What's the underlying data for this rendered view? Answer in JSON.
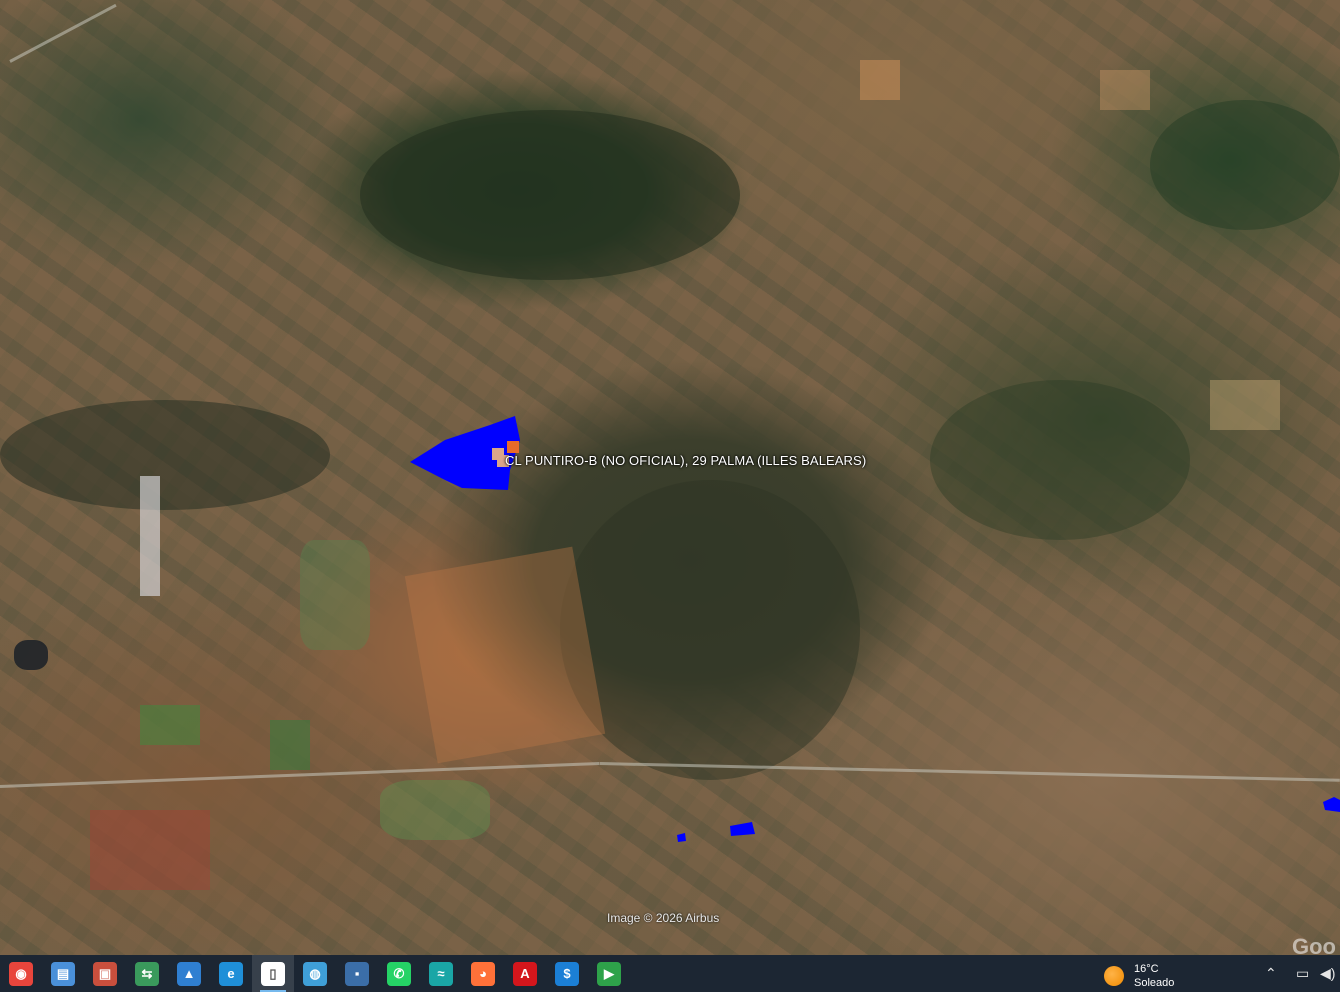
{
  "map": {
    "place_label": "CL PUNTIRO-B (NO OFICIAL), 29  PALMA (ILLES BALEARS)",
    "attribution": "Image © 2026 Airbus",
    "watermark": "Goo",
    "parcel_color": "#0000ff",
    "marker_colors": [
      "#e86a2a",
      "#d9a48a"
    ]
  },
  "taskbar": {
    "apps": [
      {
        "name": "chrome",
        "icon": "chrome-icon",
        "glyph": "◉",
        "color": "#e8453c"
      },
      {
        "name": "notes",
        "icon": "notes-icon",
        "glyph": "▤",
        "color": "#4a90d9"
      },
      {
        "name": "screenshot",
        "icon": "screenshot-icon",
        "glyph": "▣",
        "color": "#c94f3d"
      },
      {
        "name": "network-share",
        "icon": "network-share-icon",
        "glyph": "⇆",
        "color": "#3a9a5c"
      },
      {
        "name": "photos",
        "icon": "photos-icon",
        "glyph": "▲",
        "color": "#2f7fd1"
      },
      {
        "name": "edge",
        "icon": "edge-icon",
        "glyph": "e",
        "color": "#1f8fd8"
      },
      {
        "name": "document",
        "icon": "document-icon",
        "glyph": "▯",
        "color": "#ffffff"
      },
      {
        "name": "globe",
        "icon": "globe-icon",
        "glyph": "◍",
        "color": "#3f9fd8"
      },
      {
        "name": "save-disk",
        "icon": "floppy-icon",
        "glyph": "▪",
        "color": "#3b6ea8"
      },
      {
        "name": "whatsapp",
        "icon": "whatsapp-icon",
        "glyph": "✆",
        "color": "#25d366"
      },
      {
        "name": "cleaner",
        "icon": "swirl-icon",
        "glyph": "≈",
        "color": "#1aa6a6"
      },
      {
        "name": "firefox",
        "icon": "firefox-icon",
        "glyph": "◕",
        "color": "#ff7139"
      },
      {
        "name": "acrobat",
        "icon": "acrobat-icon",
        "glyph": "A",
        "color": "#d4161c"
      },
      {
        "name": "dollar-app",
        "icon": "dollar-icon",
        "glyph": "$",
        "color": "#1b7fd6"
      },
      {
        "name": "media-player",
        "icon": "play-icon",
        "glyph": "▶",
        "color": "#2ea24a"
      }
    ],
    "active_app_index": 6,
    "weather": {
      "temp": "16°C",
      "condition": "Soleado"
    }
  }
}
